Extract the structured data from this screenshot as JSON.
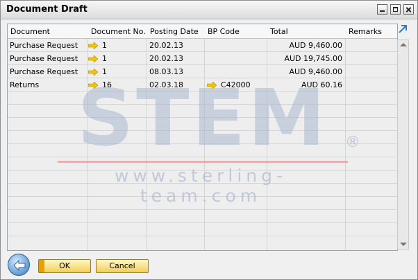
{
  "window": {
    "title": "Document Draft"
  },
  "table": {
    "columns": [
      "Document",
      "Document No.",
      "Posting Date",
      "BP Code",
      "Total",
      "Remarks"
    ],
    "rows": [
      {
        "document": "Purchase Request",
        "doc_no": "1",
        "posting_date": "20.02.13",
        "bp_code": "",
        "total": "AUD 9,460.00",
        "remarks": ""
      },
      {
        "document": "Purchase Request",
        "doc_no": "1",
        "posting_date": "20.02.13",
        "bp_code": "",
        "total": "AUD 19,745.00",
        "remarks": ""
      },
      {
        "document": "Purchase Request",
        "doc_no": "1",
        "posting_date": "08.03.13",
        "bp_code": "",
        "total": "AUD 9,460.00",
        "remarks": ""
      },
      {
        "document": "Returns",
        "doc_no": "16",
        "posting_date": "02.03.18",
        "bp_code": "C42000",
        "total": "AUD 60.16",
        "remarks": ""
      }
    ]
  },
  "watermark": {
    "brand": "STEM",
    "registered": "®",
    "url": "www.sterling-team.com"
  },
  "buttons": {
    "ok": "OK",
    "cancel": "Cancel"
  },
  "icons": {
    "link_arrow": "link-arrow-icon",
    "back": "back-arrow-icon",
    "expand": "expand-icon"
  },
  "colors": {
    "link_arrow": "#f5c400",
    "button_accent": "#e9a100",
    "watermark": "#a9b8cf"
  }
}
